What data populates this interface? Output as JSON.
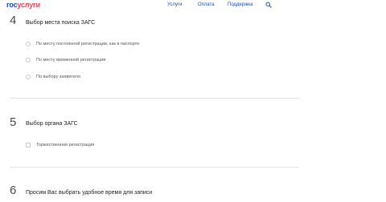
{
  "header": {
    "logo_part1": "гос",
    "logo_part2": "услуги",
    "nav": [
      "Услуги",
      "Оплата",
      "Поддержка"
    ],
    "search_icon": "search-icon"
  },
  "steps": [
    {
      "number": "4",
      "title": "Выбор места поиска ЗАГС",
      "control": "radio",
      "options": [
        "По месту постоянной регистрации, как в паспорте",
        "По месту временной регистрации",
        "По выбору заявителя"
      ]
    },
    {
      "number": "5",
      "title": "Выбор органа ЗАГС",
      "control": "checkbox",
      "options": [
        "Торжественная регистрация"
      ]
    },
    {
      "number": "6",
      "title": "Просим Вас выбрать удобное время для записи",
      "options": []
    }
  ],
  "colors": {
    "brand_blue": "#0d4cd3",
    "brand_red": "#ee3f58",
    "link": "#0d4cd3",
    "divider": "#e3e3e3"
  }
}
